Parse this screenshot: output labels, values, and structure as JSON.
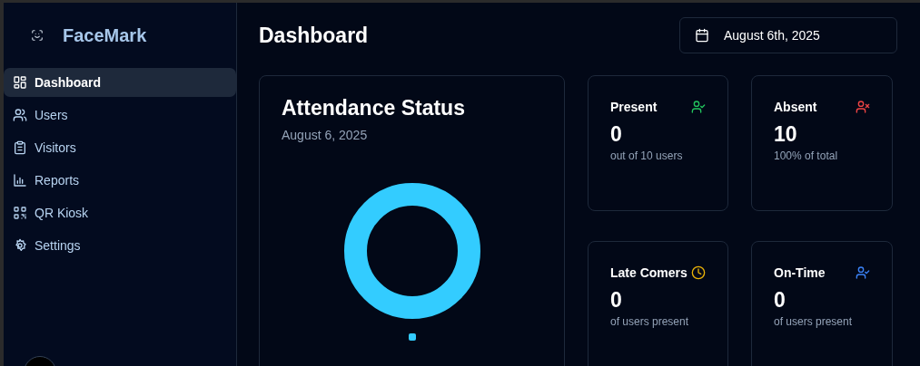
{
  "sidebar": {
    "brand": "FaceMark",
    "items": [
      {
        "label": "Dashboard",
        "kind": "grid",
        "selected": true
      },
      {
        "label": "Users",
        "kind": "users",
        "selected": false
      },
      {
        "label": "Visitors",
        "kind": "clipboard",
        "selected": false
      },
      {
        "label": "Reports",
        "kind": "chart",
        "selected": false
      },
      {
        "label": "QR Kiosk",
        "kind": "qr",
        "selected": false
      },
      {
        "label": "Settings",
        "kind": "gear",
        "selected": false
      }
    ]
  },
  "header": {
    "title": "Dashboard",
    "date_button": "August 6th, 2025"
  },
  "attendance": {
    "title": "Attendance Status",
    "date": "August 6, 2025",
    "legend": [
      {
        "color": "#33ccff"
      }
    ]
  },
  "stats": [
    {
      "label": "Present",
      "value": "0",
      "caption": "out of 10 users",
      "kind": "user-check",
      "color": "#22c55e"
    },
    {
      "label": "Absent",
      "value": "10",
      "caption": "100% of total",
      "kind": "user-x",
      "color": "#ef4444"
    },
    {
      "label": "Late Comers",
      "value": "0",
      "caption": "of users present",
      "kind": "clock",
      "color": "#eab308"
    },
    {
      "label": "On-Time",
      "value": "0",
      "caption": "of users present",
      "kind": "user-check",
      "color": "#3b82f6"
    }
  ]
}
